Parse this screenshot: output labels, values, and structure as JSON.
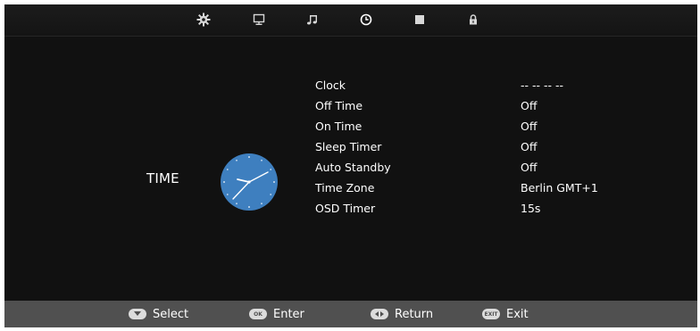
{
  "tabs": [
    {
      "icon": "gear-icon",
      "active": false
    },
    {
      "icon": "monitor-icon",
      "active": false
    },
    {
      "icon": "music-note-icon",
      "active": false
    },
    {
      "icon": "clock-icon",
      "active": true
    },
    {
      "icon": "square-icon",
      "active": false
    },
    {
      "icon": "lock-icon",
      "active": false
    }
  ],
  "section": {
    "title": "TIME",
    "icon": "clock-icon",
    "icon_color": "#3e7fbf"
  },
  "menu": [
    {
      "label": "Clock",
      "value": "-- -- -- --"
    },
    {
      "label": "Off Time",
      "value": "Off"
    },
    {
      "label": "On Time",
      "value": "Off"
    },
    {
      "label": "Sleep Timer",
      "value": "Off"
    },
    {
      "label": "Auto Standby",
      "value": "Off"
    },
    {
      "label": "Time Zone",
      "value": "Berlin GMT+1"
    },
    {
      "label": "OSD Timer",
      "value": "15s"
    }
  ],
  "footer": [
    {
      "key": "",
      "icon": "down-arrow-key-icon",
      "label": "Select"
    },
    {
      "key": "OK",
      "icon": "ok-key-icon",
      "label": "Enter"
    },
    {
      "key": "",
      "icon": "left-right-key-icon",
      "label": "Return"
    },
    {
      "key": "EXIT",
      "icon": "exit-key-icon",
      "label": "Exit"
    }
  ]
}
